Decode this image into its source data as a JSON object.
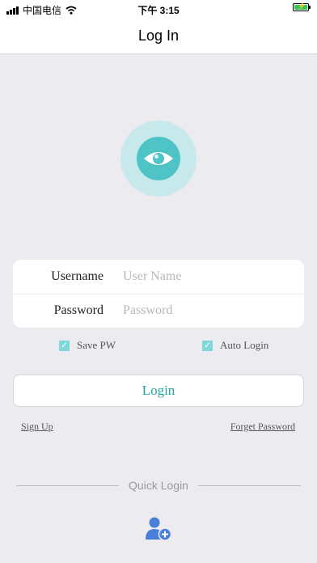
{
  "status_bar": {
    "carrier": "中国电信",
    "time": "下午 3:15",
    "icons": [
      "signal-icon",
      "wifi-icon",
      "battery-charging-icon"
    ]
  },
  "nav": {
    "title": "Log In"
  },
  "logo": {
    "icon": "eye-icon",
    "colors": {
      "outer": "#c7e9ec",
      "inner": "#4fc4c7"
    }
  },
  "form": {
    "username_label": "Username",
    "username_placeholder": "User Name",
    "username_value": "",
    "password_label": "Password",
    "password_placeholder": "Password",
    "password_value": ""
  },
  "options": {
    "save_pw_label": "Save PW",
    "save_pw_checked": true,
    "auto_login_label": "Auto Login",
    "auto_login_checked": true
  },
  "login_button_label": "Login",
  "links": {
    "sign_up": "Sign Up",
    "forget_password": "Forget Password"
  },
  "quick_login": {
    "label": "Quick Login",
    "icon": "add-user-icon"
  },
  "colors": {
    "accent": "#23a3a4",
    "background": "#ebebf0",
    "icon_blue": "#4a7fd9"
  }
}
